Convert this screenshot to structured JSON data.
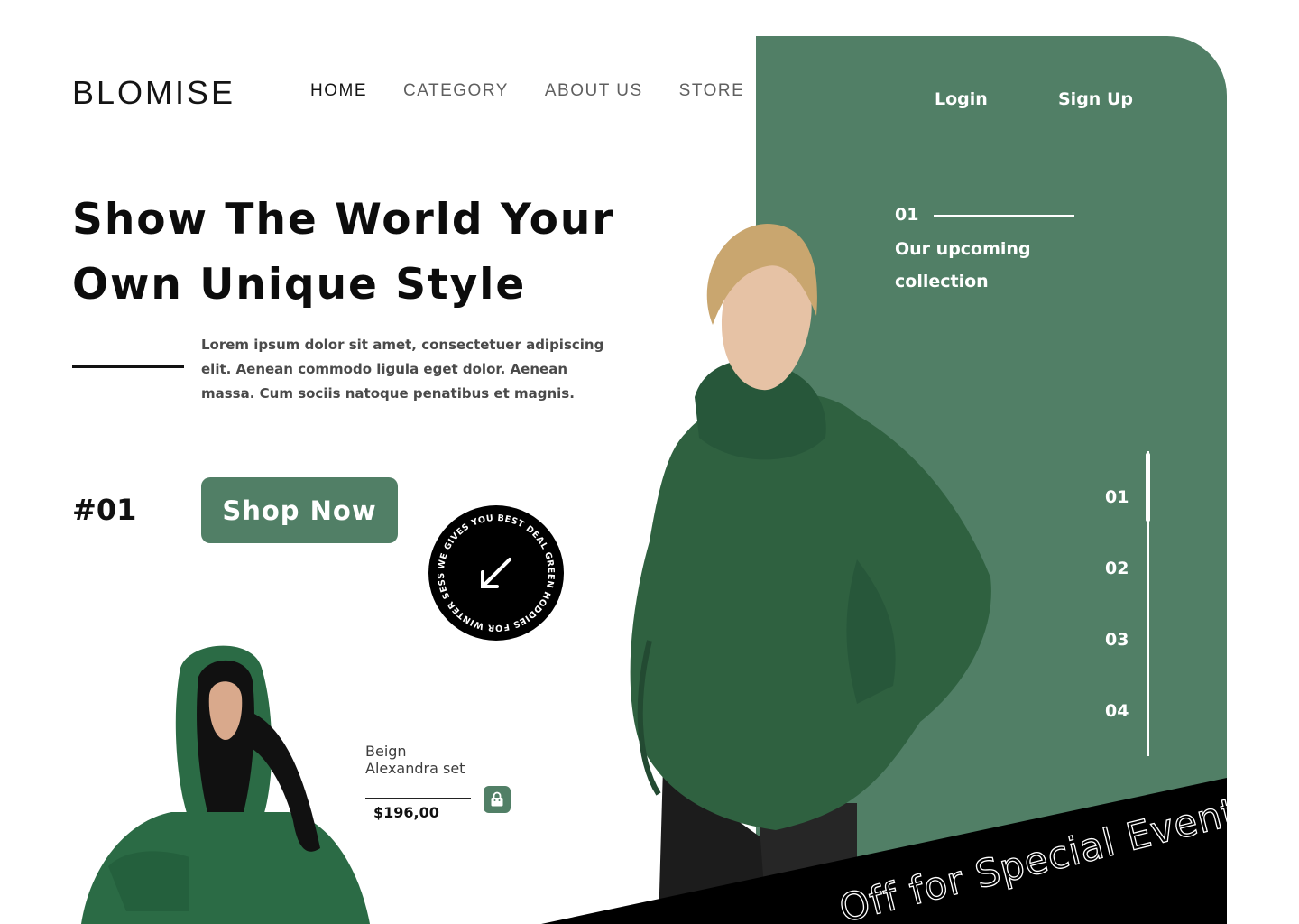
{
  "brand": {
    "logo": "BLOMISE",
    "accent_color": "#517f66",
    "dark_color": "#111111"
  },
  "nav": {
    "items": [
      {
        "label": "HOME",
        "active": true
      },
      {
        "label": "CATEGORY",
        "active": false
      },
      {
        "label": "ABOUT US",
        "active": false
      },
      {
        "label": "STORE",
        "active": false
      }
    ],
    "login_label": "Login",
    "signup_label": "Sign Up"
  },
  "hero": {
    "title_line1": "Show The World Your",
    "title_line2": "Own Unique Style",
    "description": "Lorem ipsum dolor sit amet, consectetuer adipiscing elit. Aenean commodo ligula eget dolor. Aenean massa. Cum sociis natoque penatibus et magnis.",
    "number": "#01",
    "cta_label": "Shop Now"
  },
  "badge": {
    "text": "WE GIVES YOU BEST DEAL GREEN HODDIES FOR WINTER SESSION LIMITED.",
    "icon": "arrow-down-left-icon"
  },
  "upcoming": {
    "number": "01",
    "text_line1": "Our upcoming",
    "text_line2": "collection"
  },
  "pager": {
    "items": [
      "01",
      "02",
      "03",
      "04"
    ],
    "active_index": 0
  },
  "product": {
    "name_line1": "Beign",
    "name_line2": "Alexandra set",
    "price": "$196,00",
    "cart_icon": "shopping-bag-icon"
  },
  "event_banner": {
    "text": "Off for Special Event"
  }
}
